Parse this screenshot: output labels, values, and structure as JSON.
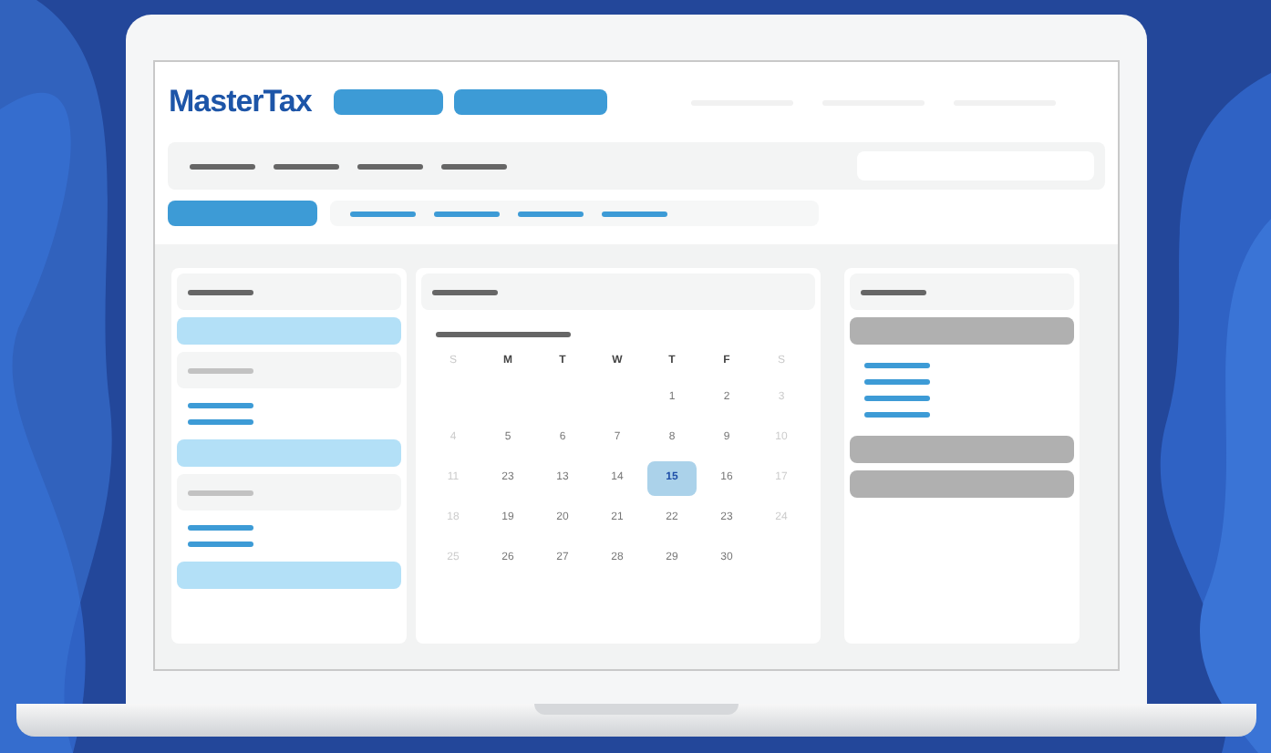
{
  "logo": "MasterTax",
  "calendar": {
    "weekdays": [
      {
        "label": "S",
        "muted": true
      },
      {
        "label": "M",
        "muted": false
      },
      {
        "label": "T",
        "muted": false
      },
      {
        "label": "W",
        "muted": false
      },
      {
        "label": "T",
        "muted": false
      },
      {
        "label": "F",
        "muted": false
      },
      {
        "label": "S",
        "muted": true
      }
    ],
    "weeks": [
      [
        {
          "kind": "blank"
        },
        {
          "kind": "blank"
        },
        {
          "kind": "blank"
        },
        {
          "kind": "blank"
        },
        {
          "kind": "day",
          "label": "1",
          "muted": false,
          "selected": false
        },
        {
          "kind": "day",
          "label": "2",
          "muted": false,
          "selected": false
        },
        {
          "kind": "day",
          "label": "3",
          "muted": true,
          "selected": false
        }
      ],
      [
        {
          "kind": "day",
          "label": "4",
          "muted": true,
          "selected": false
        },
        {
          "kind": "day",
          "label": "5",
          "muted": false,
          "selected": false
        },
        {
          "kind": "day",
          "label": "6",
          "muted": false,
          "selected": false
        },
        {
          "kind": "day",
          "label": "7",
          "muted": false,
          "selected": false
        },
        {
          "kind": "day",
          "label": "8",
          "muted": false,
          "selected": false
        },
        {
          "kind": "day",
          "label": "9",
          "muted": false,
          "selected": false
        },
        {
          "kind": "day",
          "label": "10",
          "muted": true,
          "selected": false
        }
      ],
      [
        {
          "kind": "day",
          "label": "11",
          "muted": true,
          "selected": false
        },
        {
          "kind": "day",
          "label": "23",
          "muted": false,
          "selected": false
        },
        {
          "kind": "day",
          "label": "13",
          "muted": false,
          "selected": false
        },
        {
          "kind": "day",
          "label": "14",
          "muted": false,
          "selected": false
        },
        {
          "kind": "day",
          "label": "15",
          "muted": false,
          "selected": true
        },
        {
          "kind": "day",
          "label": "16",
          "muted": false,
          "selected": false
        },
        {
          "kind": "day",
          "label": "17",
          "muted": true,
          "selected": false
        }
      ],
      [
        {
          "kind": "day",
          "label": "18",
          "muted": true,
          "selected": false
        },
        {
          "kind": "day",
          "label": "19",
          "muted": false,
          "selected": false
        },
        {
          "kind": "day",
          "label": "20",
          "muted": false,
          "selected": false
        },
        {
          "kind": "day",
          "label": "21",
          "muted": false,
          "selected": false
        },
        {
          "kind": "day",
          "label": "22",
          "muted": false,
          "selected": false
        },
        {
          "kind": "day",
          "label": "23",
          "muted": false,
          "selected": false
        },
        {
          "kind": "day",
          "label": "24",
          "muted": true,
          "selected": false
        }
      ],
      [
        {
          "kind": "day",
          "label": "25",
          "muted": true,
          "selected": false
        },
        {
          "kind": "day",
          "label": "26",
          "muted": false,
          "selected": false
        },
        {
          "kind": "day",
          "label": "27",
          "muted": false,
          "selected": false
        },
        {
          "kind": "day",
          "label": "28",
          "muted": false,
          "selected": false
        },
        {
          "kind": "day",
          "label": "29",
          "muted": false,
          "selected": false
        },
        {
          "kind": "day",
          "label": "30",
          "muted": false,
          "selected": false
        },
        {
          "kind": "blank"
        }
      ]
    ]
  }
}
